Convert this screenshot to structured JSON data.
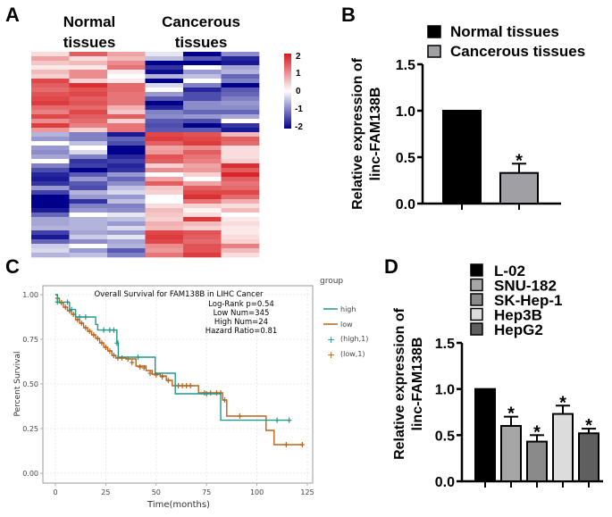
{
  "chart_data": [
    {
      "panel": "A",
      "type": "heatmap",
      "title": "",
      "group_labels": [
        "Normal\ntissues",
        "Cancerous\ntissues"
      ],
      "group_label_lines": [
        [
          "Normal",
          "tissues"
        ],
        [
          "Cancerous",
          "tissues"
        ]
      ],
      "columns": 6,
      "colorbar": {
        "min": -2,
        "max": 2,
        "ticks": [
          "2",
          "1",
          "0",
          "-1",
          "-2"
        ],
        "low_color": "#00008b",
        "mid_color": "#ffffff",
        "high_color": "#d7191c"
      },
      "values": [
        [
          0.3,
          1.4,
          0.8,
          -0.2,
          -2,
          -0.9
        ],
        [
          0.8,
          0.3,
          0.6,
          -0.5,
          -1.3,
          -1.7
        ],
        [
          0.5,
          0.6,
          1.0,
          -2,
          -2,
          -1.8
        ],
        [
          0.2,
          0.2,
          1.2,
          -1.6,
          0,
          -0.7
        ],
        [
          0.6,
          1.0,
          0.2,
          -1.9,
          -0.8,
          -0.6
        ],
        [
          0.4,
          1.0,
          0,
          -0.6,
          -0.5,
          -1.2
        ],
        [
          1.6,
          0.4,
          0.2,
          -2,
          0,
          -1.0
        ],
        [
          1.4,
          1.8,
          1.3,
          -0.3,
          -1.0,
          -2
        ],
        [
          1.3,
          1.5,
          1.3,
          0,
          -1.7,
          -1.3
        ],
        [
          1.5,
          1.6,
          1.2,
          -0.8,
          -1.4,
          -1.2
        ],
        [
          1.6,
          1.4,
          1.2,
          -1.3,
          -1.4,
          -1.0
        ],
        [
          1.7,
          1.5,
          1.2,
          -2,
          -0.9,
          -0.8
        ],
        [
          1.3,
          1.3,
          0.7,
          -1.7,
          -0.9,
          -0.9
        ],
        [
          1.1,
          1.6,
          0.5,
          -1.0,
          -1.2,
          -1.2
        ],
        [
          1.6,
          1.4,
          1.4,
          -0.9,
          -0.8,
          -0.7
        ],
        [
          1.0,
          1.3,
          0.4,
          -1.3,
          -1.4,
          0
        ],
        [
          1.7,
          1.1,
          1.2,
          -1.4,
          -2,
          -1.6
        ],
        [
          0.9,
          0.4,
          1.2,
          -1.3,
          -1.3,
          -1.8
        ],
        [
          -0.6,
          -1.0,
          -1.8,
          1.6,
          1.5,
          0.6
        ],
        [
          -0.8,
          -1.0,
          -1.2,
          1.7,
          1.6,
          1.4
        ],
        [
          0,
          -0.5,
          -1.4,
          1.4,
          1.7,
          1.3
        ],
        [
          -0.8,
          0,
          -2,
          0.8,
          1.0,
          0.3
        ],
        [
          -0.9,
          -0.3,
          -2,
          0.9,
          1.4,
          0.3
        ],
        [
          -0.7,
          -1.0,
          -1.7,
          1.5,
          1.2,
          0.3
        ],
        [
          0,
          -1.6,
          -1.5,
          1.4,
          1.1,
          0.4
        ],
        [
          -1.0,
          -1.5,
          -1.7,
          0.4,
          0.8,
          1.8
        ],
        [
          -1.4,
          -2,
          -1.6,
          1.0,
          0.9,
          1.4
        ],
        [
          -1.7,
          -1.3,
          -0.8,
          0,
          0.4,
          1.9
        ],
        [
          -1.8,
          -0.8,
          -1.2,
          0.8,
          0,
          1.4
        ],
        [
          -1.6,
          -1.3,
          -0.9,
          1.4,
          0.8,
          1.2
        ],
        [
          -0.8,
          -1.4,
          -0.5,
          0.5,
          1.4,
          1.3
        ],
        [
          -1.5,
          -0.6,
          -0.3,
          0.4,
          1.6,
          1.6
        ],
        [
          -2,
          -0.8,
          -0.8,
          0,
          1.8,
          1.3
        ],
        [
          -2,
          -1.6,
          -0.5,
          0,
          1.2,
          0.7
        ],
        [
          -2,
          -1.0,
          -1.0,
          0.3,
          0.4,
          0.3
        ],
        [
          -1.8,
          -0.8,
          -0.9,
          0.6,
          0.1,
          0.6
        ],
        [
          -1.2,
          0,
          -0.2,
          0.5,
          0.3,
          0
        ],
        [
          -0.7,
          -0.6,
          -0.5,
          0.4,
          1.7,
          0.2
        ],
        [
          -0.7,
          -0.6,
          -0.8,
          0.7,
          0.6,
          0.3
        ],
        [
          -0.6,
          -0.6,
          -0.3,
          0.6,
          0.4,
          0.2
        ],
        [
          -1.5,
          -0.7,
          -0.8,
          1.6,
          1.5,
          0.2
        ],
        [
          -1.8,
          -0.4,
          -0.2,
          1.7,
          1.4,
          0.3
        ],
        [
          -1.2,
          -0.9,
          -0.7,
          1.6,
          1.3,
          0.4
        ],
        [
          -0.4,
          0,
          -0.6,
          1.0,
          1.5,
          1.1
        ],
        [
          -0.3,
          -0.8,
          -1.3,
          0.9,
          1.5,
          0.6
        ],
        [
          -0.6,
          -0.5,
          -1.0,
          1.2,
          1.7,
          0.3
        ]
      ]
    },
    {
      "panel": "B",
      "type": "bar",
      "title": "",
      "categories": [
        "Normal tissues",
        "Cancerous tissues"
      ],
      "values": [
        1.0,
        0.33
      ],
      "errors": [
        0,
        0.1
      ],
      "significance": [
        "",
        "*"
      ],
      "colors": [
        "#000000",
        "#a0a0a4"
      ],
      "ylabel_lines": [
        "Relative expression of",
        "linc-FAM138B"
      ],
      "xlabel": "",
      "ylim": [
        0,
        1.5
      ],
      "yticks": [
        "0.0",
        "0.5",
        "1.0",
        "1.5"
      ],
      "legend": [
        "Normal tissues",
        "Cancerous tissues"
      ],
      "legend_position": "top-right"
    },
    {
      "panel": "C",
      "type": "line",
      "title": "Overall Survival for FAM138B in LIHC Cancer",
      "annotations": [
        "Log-Rank p=0.54",
        "Low Num=345",
        "High Num=24",
        "Hazard Ratio=0.81"
      ],
      "xlabel": "Time(months)",
      "ylabel": "Percent Survival",
      "xlim": [
        -5,
        128
      ],
      "ylim": [
        -0.04,
        1.03
      ],
      "xticks": [
        "0",
        "25",
        "50",
        "75",
        "100",
        "125"
      ],
      "yticks": [
        "0.00",
        "0.25",
        "0.50",
        "0.75",
        "1.00"
      ],
      "grid": true,
      "legend_title": "group",
      "legend": [
        "high",
        "low",
        "(high,1)",
        "(low,1)"
      ],
      "legend_position": "right",
      "series": [
        {
          "name": "high",
          "color": "#20998a",
          "steps": [
            [
              0,
              1.0
            ],
            [
              1,
              0.958
            ],
            [
              7,
              0.917
            ],
            [
              10,
              0.875
            ],
            [
              15,
              0.875
            ],
            [
              20,
              0.833
            ],
            [
              21,
              0.802
            ],
            [
              30,
              0.802
            ],
            [
              30.5,
              0.74
            ],
            [
              31,
              0.729
            ],
            [
              31.2,
              0.65
            ],
            [
              49,
              0.65
            ],
            [
              49.5,
              0.56
            ],
            [
              59,
              0.56
            ],
            [
              59.5,
              0.445
            ],
            [
              81.5,
              0.445
            ],
            [
              82,
              0.297
            ],
            [
              116,
              0.297
            ]
          ],
          "censors": [
            [
              1,
              0.958
            ],
            [
              6,
              0.958
            ],
            [
              8,
              0.917
            ],
            [
              12,
              0.875
            ],
            [
              15,
              0.875
            ],
            [
              24,
              0.802
            ],
            [
              27,
              0.802
            ],
            [
              29,
              0.802
            ],
            [
              30.5,
              0.729
            ],
            [
              41,
              0.65
            ],
            [
              75,
              0.445
            ],
            [
              110,
              0.297
            ],
            [
              116,
              0.297
            ]
          ]
        },
        {
          "name": "low",
          "color": "#b9631b",
          "steps": [
            [
              0,
              1.0
            ],
            [
              1,
              0.98
            ],
            [
              2,
              0.955
            ],
            [
              4,
              0.93
            ],
            [
              6,
              0.91
            ],
            [
              8,
              0.89
            ],
            [
              10,
              0.86
            ],
            [
              12,
              0.84
            ],
            [
              14,
              0.815
            ],
            [
              16,
              0.795
            ],
            [
              18,
              0.775
            ],
            [
              20,
              0.755
            ],
            [
              22,
              0.73
            ],
            [
              24,
              0.705
            ],
            [
              26,
              0.685
            ],
            [
              28,
              0.66
            ],
            [
              30,
              0.645
            ],
            [
              35,
              0.64
            ],
            [
              40,
              0.6
            ],
            [
              45,
              0.575
            ],
            [
              48,
              0.555
            ],
            [
              52,
              0.545
            ],
            [
              55,
              0.52
            ],
            [
              58,
              0.49
            ],
            [
              65,
              0.49
            ],
            [
              70,
              0.49
            ],
            [
              71,
              0.45
            ],
            [
              82,
              0.45
            ],
            [
              83,
              0.41
            ],
            [
              85,
              0.32
            ],
            [
              104,
              0.32
            ],
            [
              104.5,
              0.24
            ],
            [
              108,
              0.24
            ],
            [
              108.5,
              0.16
            ],
            [
              122.5,
              0.16
            ]
          ],
          "censors": [
            [
              1,
              0.98
            ],
            [
              3,
              0.955
            ],
            [
              5,
              0.93
            ],
            [
              7,
              0.91
            ],
            [
              9,
              0.89
            ],
            [
              11,
              0.86
            ],
            [
              13,
              0.84
            ],
            [
              15,
              0.815
            ],
            [
              17,
              0.795
            ],
            [
              19,
              0.775
            ],
            [
              21,
              0.755
            ],
            [
              23,
              0.73
            ],
            [
              25,
              0.705
            ],
            [
              27,
              0.685
            ],
            [
              29,
              0.66
            ],
            [
              31,
              0.645
            ],
            [
              33,
              0.645
            ],
            [
              36,
              0.64
            ],
            [
              38,
              0.62
            ],
            [
              42,
              0.595
            ],
            [
              44,
              0.59
            ],
            [
              47,
              0.56
            ],
            [
              50,
              0.55
            ],
            [
              53,
              0.54
            ],
            [
              56,
              0.52
            ],
            [
              61,
              0.49
            ],
            [
              63,
              0.49
            ],
            [
              65,
              0.49
            ],
            [
              67,
              0.49
            ],
            [
              74,
              0.45
            ],
            [
              77,
              0.45
            ],
            [
              80,
              0.45
            ],
            [
              82,
              0.45
            ],
            [
              84,
              0.41
            ],
            [
              91.5,
              0.32
            ],
            [
              114.5,
              0.16
            ],
            [
              122.5,
              0.16
            ]
          ]
        }
      ]
    },
    {
      "panel": "D",
      "type": "bar",
      "title": "",
      "categories": [
        "L-02",
        "SNU-182",
        "SK-Hep-1",
        "Hep3B",
        "HepG2"
      ],
      "values": [
        1.0,
        0.6,
        0.43,
        0.73,
        0.52
      ],
      "errors": [
        0,
        0.1,
        0.07,
        0.09,
        0.05
      ],
      "significance": [
        "",
        "*",
        "*",
        "*",
        "*"
      ],
      "colors": [
        "#000000",
        "#a6a6a6",
        "#8a8a8a",
        "#dcdcdc",
        "#5f5f5f"
      ],
      "ylabel_lines": [
        "Relative expression of",
        "linc-FAM138B"
      ],
      "xlabel": "",
      "ylim": [
        0,
        1.5
      ],
      "yticks": [
        "0.0",
        "0.5",
        "1.0",
        "1.5"
      ],
      "legend": [
        "L-02",
        "SNU-182",
        "SK-Hep-1",
        "Hep3B",
        "HepG2"
      ],
      "legend_position": "top"
    }
  ],
  "panel_letters": {
    "a": "A",
    "b": "B",
    "c": "C",
    "d": "D"
  }
}
